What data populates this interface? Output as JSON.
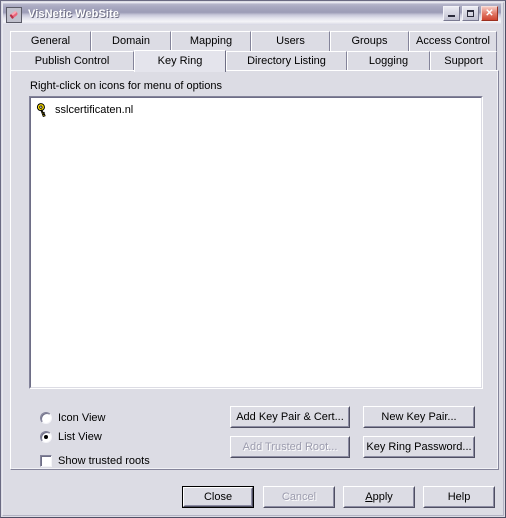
{
  "window": {
    "title": "VisNetic WebSite",
    "icon": "keyring-app-icon",
    "controls": {
      "minimize": "minimize-icon",
      "maximize": "maximize-icon",
      "close_glyph": "✕"
    }
  },
  "tabs": {
    "row1": [
      {
        "label": "General",
        "active": false
      },
      {
        "label": "Domain",
        "active": false
      },
      {
        "label": "Mapping",
        "active": false
      },
      {
        "label": "Users",
        "active": false
      },
      {
        "label": "Groups",
        "active": false
      },
      {
        "label": "Access Control",
        "active": false
      }
    ],
    "row2": [
      {
        "label": "Publish Control",
        "active": false
      },
      {
        "label": "Key Ring",
        "active": true
      },
      {
        "label": "Directory Listing",
        "active": false
      },
      {
        "label": "Logging",
        "active": false
      },
      {
        "label": "Support",
        "active": false
      }
    ]
  },
  "panel": {
    "hint": "Right-click on icons for menu of options",
    "list": {
      "items": [
        {
          "icon": "key-icon",
          "label": "sslcertificaten.nl"
        }
      ]
    },
    "view_options": [
      {
        "label": "Icon View",
        "selected": false
      },
      {
        "label": "List View",
        "selected": true
      }
    ],
    "show_trusted_roots": {
      "label": "Show trusted roots",
      "checked": false
    },
    "action_buttons": [
      {
        "label": "Add Key Pair & Cert...",
        "enabled": true
      },
      {
        "label": "New Key Pair...",
        "enabled": true
      },
      {
        "label": "Add Trusted Root...",
        "enabled": false
      },
      {
        "label": "Key Ring Password...",
        "enabled": true
      }
    ]
  },
  "dialog_buttons": [
    {
      "label": "Close",
      "enabled": true,
      "default": true
    },
    {
      "label": "Cancel",
      "enabled": false,
      "default": false
    },
    {
      "label": "Apply",
      "enabled": true,
      "default": false,
      "mnemonic": "A"
    },
    {
      "label": "Help",
      "enabled": true,
      "default": false
    }
  ],
  "colors": {
    "face": "#dcdce4",
    "field": "#ffffff",
    "disabled_text": "#9c9cae",
    "key_yellow": "#ffe000"
  }
}
